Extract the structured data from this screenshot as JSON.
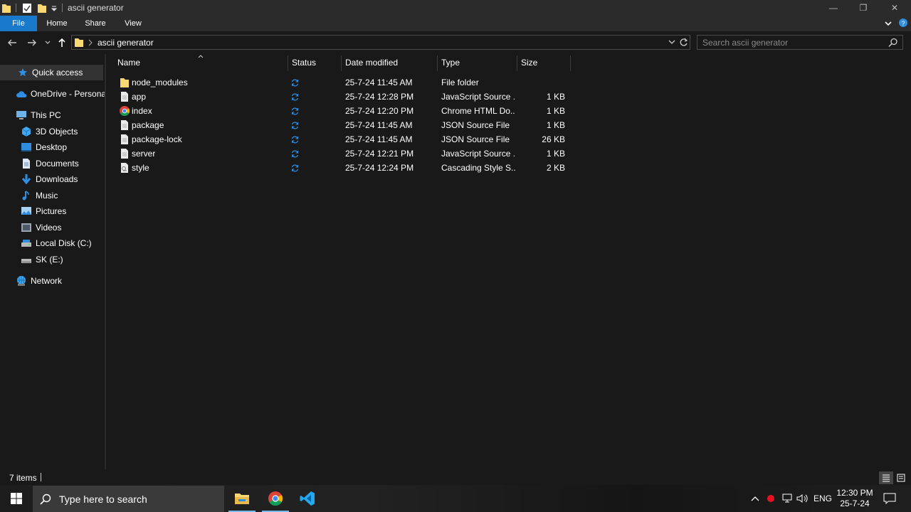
{
  "window": {
    "title": "ascii generator",
    "minimize_glyph": "—",
    "restore_glyph": "❐",
    "close_glyph": "✕"
  },
  "ribbon": {
    "tabs": [
      {
        "label": "File"
      },
      {
        "label": "Home"
      },
      {
        "label": "Share"
      },
      {
        "label": "View"
      }
    ]
  },
  "address": {
    "path": "ascii generator",
    "search_placeholder": "Search ascii generator"
  },
  "sidebar": {
    "items": [
      {
        "label": "Quick access",
        "icon": "star-icon"
      },
      {
        "label": "OneDrive - Personal",
        "icon": "cloud-icon"
      },
      {
        "label": "This PC",
        "icon": "computer-icon"
      },
      {
        "label": "3D Objects",
        "icon": "cube-icon"
      },
      {
        "label": "Desktop",
        "icon": "desktop-icon"
      },
      {
        "label": "Documents",
        "icon": "documents-icon"
      },
      {
        "label": "Downloads",
        "icon": "downloads-icon"
      },
      {
        "label": "Music",
        "icon": "music-icon"
      },
      {
        "label": "Pictures",
        "icon": "pictures-icon"
      },
      {
        "label": "Videos",
        "icon": "videos-icon"
      },
      {
        "label": "Local Disk (C:)",
        "icon": "drive-icon"
      },
      {
        "label": "SK (E:)",
        "icon": "usb-drive-icon"
      },
      {
        "label": "Network",
        "icon": "network-icon"
      }
    ]
  },
  "columns": {
    "name": "Name",
    "status": "Status",
    "date": "Date modified",
    "type": "Type",
    "size": "Size"
  },
  "files": [
    {
      "name": "node_modules",
      "icon": "folder-icon",
      "date": "25-7-24 11:45 AM",
      "type": "File folder",
      "size": ""
    },
    {
      "name": "app",
      "icon": "file-icon",
      "date": "25-7-24 12:28 PM",
      "type": "JavaScript Source ...",
      "size": "1 KB"
    },
    {
      "name": "index",
      "icon": "chrome-icon",
      "date": "25-7-24 12:20 PM",
      "type": "Chrome HTML Do...",
      "size": "1 KB"
    },
    {
      "name": "package",
      "icon": "file-icon",
      "date": "25-7-24 11:45 AM",
      "type": "JSON Source File",
      "size": "1 KB"
    },
    {
      "name": "package-lock",
      "icon": "file-icon",
      "date": "25-7-24 11:45 AM",
      "type": "JSON Source File",
      "size": "26 KB"
    },
    {
      "name": "server",
      "icon": "file-icon",
      "date": "25-7-24 12:21 PM",
      "type": "JavaScript Source ...",
      "size": "1 KB"
    },
    {
      "name": "style",
      "icon": "css-file-icon",
      "date": "25-7-24 12:24 PM",
      "type": "Cascading Style S...",
      "size": "2 KB"
    }
  ],
  "status_bar": {
    "item_count": "7 items"
  },
  "taskbar": {
    "search_placeholder": "Type here to search",
    "language": "ENG",
    "time": "12:30 PM",
    "date": "25-7-24"
  },
  "colors": {
    "accent": "#1979ca",
    "folder": "#f8d775",
    "sync": "#2f8ee0",
    "background": "#191919"
  }
}
